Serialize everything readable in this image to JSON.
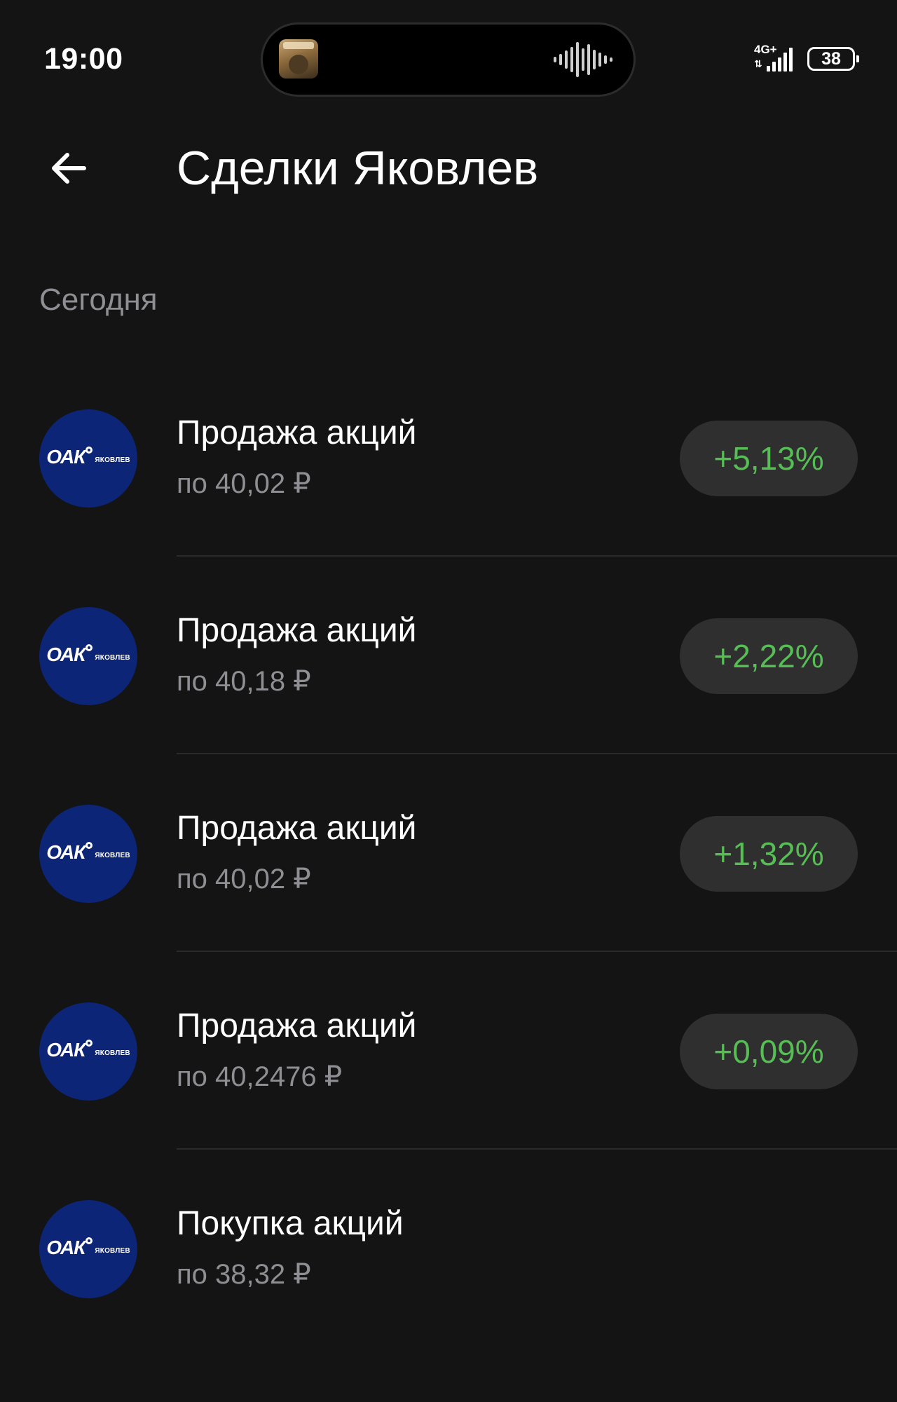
{
  "status_bar": {
    "time": "19:00",
    "network": "4G+",
    "battery": "38",
    "icons": [
      "now-playing-art-icon",
      "audio-waveform-icon",
      "signal-icon",
      "battery-icon"
    ]
  },
  "header": {
    "title": "Сделки Яковлев",
    "back_icon": "arrow-left-icon"
  },
  "section": {
    "title": "Сегодня"
  },
  "company_logo": {
    "main": "ОАК",
    "sub": "ЯКОВЛЕВ",
    "color": "#0c2576"
  },
  "colors": {
    "background": "#141414",
    "positive": "#57bd55",
    "secondary_text": "#8e8e93",
    "badge_background": "#2f2f2f"
  },
  "deals": [
    {
      "title": "Продажа акций",
      "price": "по 40,02 ₽",
      "change": "+5,13%"
    },
    {
      "title": "Продажа акций",
      "price": "по 40,18 ₽",
      "change": "+2,22%"
    },
    {
      "title": "Продажа акций",
      "price": "по 40,02 ₽",
      "change": "+1,32%"
    },
    {
      "title": "Продажа акций",
      "price": "по 40,2476 ₽",
      "change": "+0,09%"
    },
    {
      "title": "Покупка акций",
      "price": "по 38,32 ₽",
      "change": ""
    }
  ]
}
